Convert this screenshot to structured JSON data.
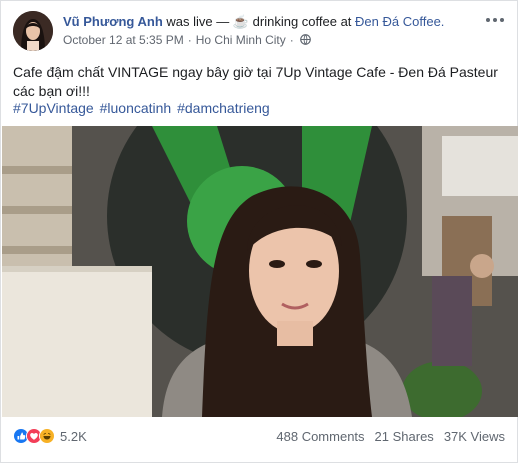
{
  "post": {
    "author_name": "Vũ Phương Anh",
    "activity": " was live — ☕ drinking coffee at ",
    "place": "Đen Đá Coffee.",
    "date": "October 12 at 5:35 PM",
    "separator1": "·",
    "location": "Ho Chi Minh City",
    "separator2": "·",
    "privacy_icon": "globe-icon",
    "message": "Cafe đậm chất VINTAGE ngay bây giờ tại 7Up Vintage Cafe - Đen Đá Pasteur các bạn ơi!!!",
    "hashtags": [
      "#7UpVintage",
      "#luoncatinh",
      "#damchatrieng"
    ]
  },
  "reactions": {
    "icons": [
      "like-icon",
      "love-icon",
      "haha-icon"
    ],
    "count": "5.2K"
  },
  "stats": {
    "comments": "488 Comments",
    "shares": "21 Shares",
    "views": "37K Views"
  },
  "colors": {
    "link": "#365899",
    "secondary_text": "#616770",
    "like": "#1877f2",
    "love": "#f33e58",
    "haha": "#f7b125"
  }
}
